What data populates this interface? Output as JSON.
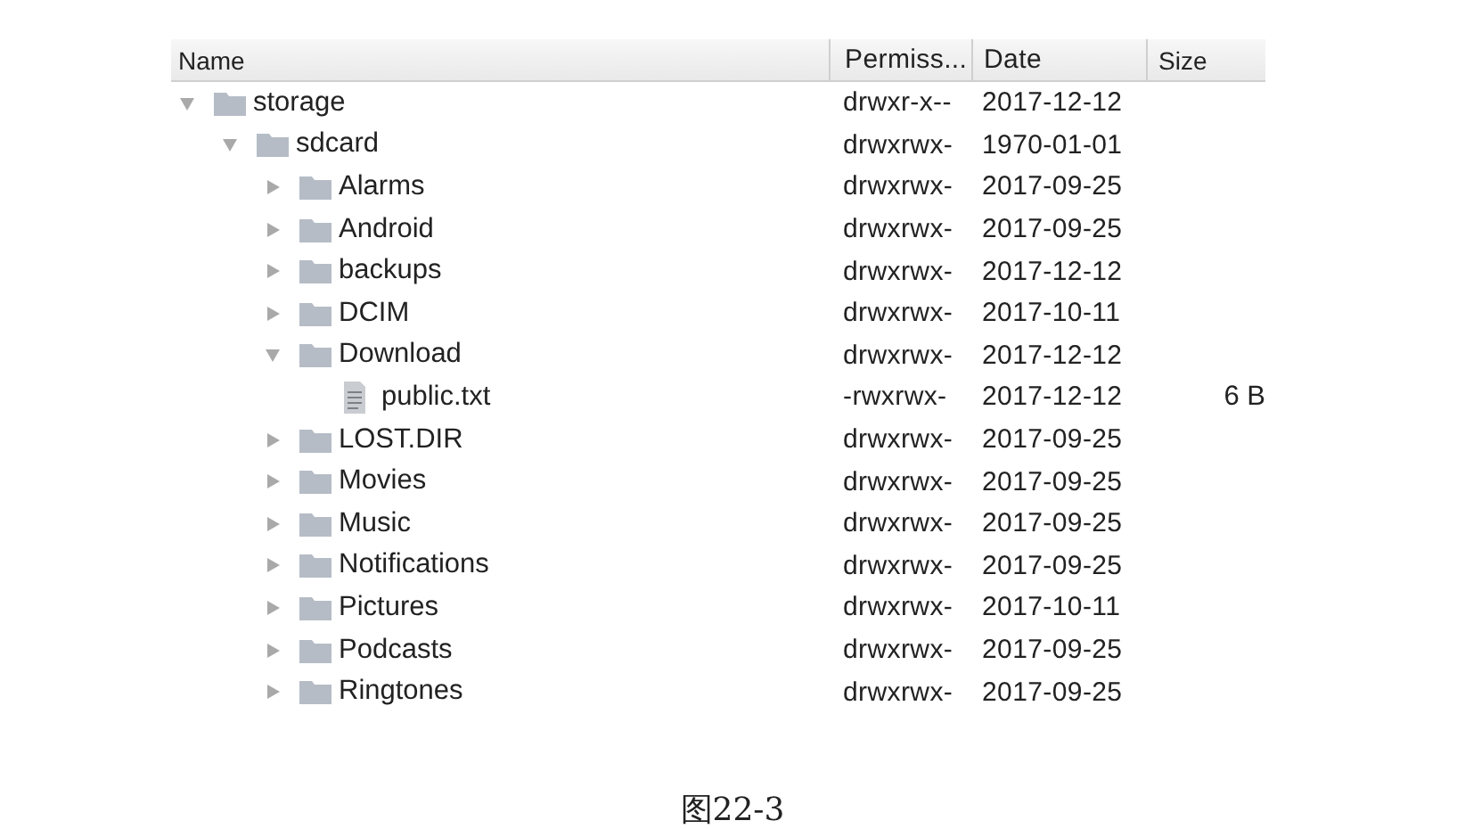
{
  "table": {
    "columns": [
      "Name",
      "Permiss...",
      "Date",
      "Size"
    ],
    "tree": [
      {
        "kind": "folder",
        "name": "storage",
        "permissions": "drwxr-x--",
        "date": "2017-12-12",
        "expanded": true,
        "children": [
          {
            "kind": "folder",
            "name": "sdcard",
            "permissions": "drwxrwx-",
            "date": "1970-01-01",
            "expanded": true,
            "children": [
              {
                "kind": "folder",
                "name": "Alarms",
                "permissions": "drwxrwx-",
                "date": "2017-09-25",
                "expanded": false
              },
              {
                "kind": "folder",
                "name": "Android",
                "permissions": "drwxrwx-",
                "date": "2017-09-25",
                "expanded": false
              },
              {
                "kind": "folder",
                "name": "backups",
                "permissions": "drwxrwx-",
                "date": "2017-12-12",
                "expanded": false
              },
              {
                "kind": "folder",
                "name": "DCIM",
                "permissions": "drwxrwx-",
                "date": "2017-10-11",
                "expanded": false
              },
              {
                "kind": "folder",
                "name": "Download",
                "permissions": "drwxrwx-",
                "date": "2017-12-12",
                "expanded": true,
                "children": [
                  {
                    "kind": "file",
                    "name": "public.txt",
                    "permissions": "-rwxrwx-",
                    "date": "2017-12-12",
                    "size": "6 B"
                  }
                ]
              },
              {
                "kind": "folder",
                "name": "LOST.DIR",
                "permissions": "drwxrwx-",
                "date": "2017-09-25",
                "expanded": false
              },
              {
                "kind": "folder",
                "name": "Movies",
                "permissions": "drwxrwx-",
                "date": "2017-09-25",
                "expanded": false
              },
              {
                "kind": "folder",
                "name": "Music",
                "permissions": "drwxrwx-",
                "date": "2017-09-25",
                "expanded": false
              },
              {
                "kind": "folder",
                "name": "Notifications",
                "permissions": "drwxrwx-",
                "date": "2017-09-25",
                "expanded": false
              },
              {
                "kind": "folder",
                "name": "Pictures",
                "permissions": "drwxrwx-",
                "date": "2017-10-11",
                "expanded": false
              },
              {
                "kind": "folder",
                "name": "Podcasts",
                "permissions": "drwxrwx-",
                "date": "2017-09-25",
                "expanded": false
              },
              {
                "kind": "folder",
                "name": "Ringtones",
                "permissions": "drwxrwx-",
                "date": "2017-09-25",
                "expanded": false
              }
            ]
          }
        ]
      }
    ]
  },
  "caption": "图22-3"
}
